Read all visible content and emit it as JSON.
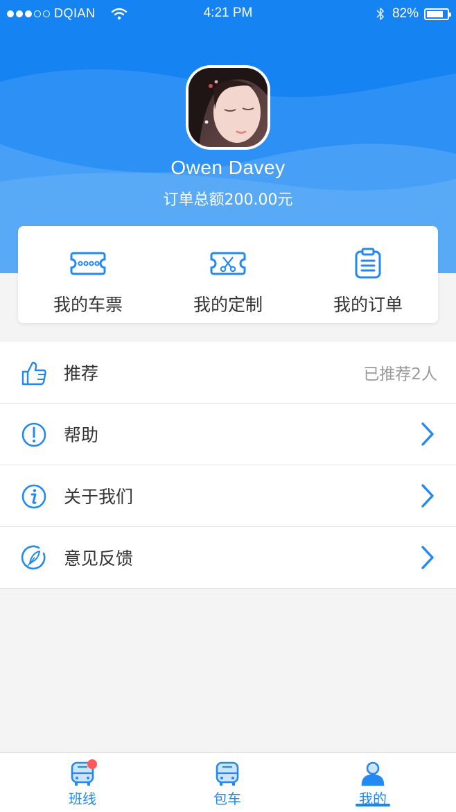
{
  "status_bar": {
    "carrier": "DQIAN",
    "time": "4:21 PM",
    "battery": "82%",
    "battery_level": 0.82
  },
  "profile": {
    "name": "Owen Davey",
    "order_total": "订单总额200.00元"
  },
  "quick_actions": [
    {
      "label": "我的车票",
      "icon": "ticket-icon"
    },
    {
      "label": "我的定制",
      "icon": "custom-ticket-icon"
    },
    {
      "label": "我的订单",
      "icon": "clipboard-icon"
    }
  ],
  "menu": [
    {
      "label": "推荐",
      "icon": "thumbs-up-icon",
      "value": "已推荐2人"
    },
    {
      "label": "帮助",
      "icon": "exclamation-circle-icon"
    },
    {
      "label": "关于我们",
      "icon": "info-circle-icon"
    },
    {
      "label": "意见反馈",
      "icon": "feather-compass-icon"
    }
  ],
  "tabbar": [
    {
      "label": "班线",
      "icon": "bus-icon",
      "badge": true
    },
    {
      "label": "包车",
      "icon": "bus-icon"
    },
    {
      "label": "我的",
      "icon": "person-icon",
      "active": true
    }
  ],
  "colors": {
    "primary": "#1c86f2",
    "badge": "#ff5a5a",
    "text": "#333333",
    "muted": "#999999"
  }
}
